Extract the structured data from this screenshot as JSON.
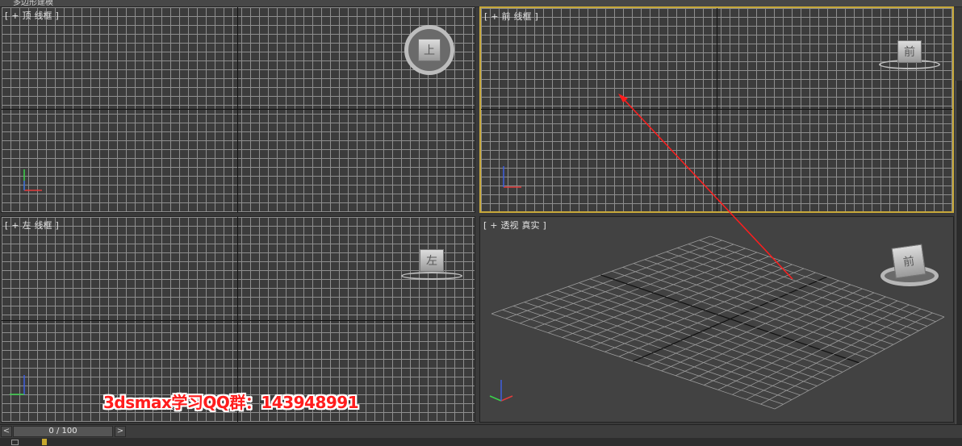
{
  "header": {
    "title": "多边形建模"
  },
  "viewports": {
    "top": {
      "bracket_open": "[",
      "plus": "+",
      "name": "顶",
      "mode": "线框",
      "bracket_close": "]",
      "viewcube_label": "上"
    },
    "front": {
      "bracket_open": "[",
      "plus": "+",
      "name": "前",
      "mode": "线框",
      "bracket_close": "]",
      "viewcube_label": "前"
    },
    "left": {
      "bracket_open": "[",
      "plus": "+",
      "name": "左",
      "mode": "线框",
      "bracket_close": "]",
      "viewcube_label": "左"
    },
    "perspective": {
      "bracket_open": "[",
      "plus": "+",
      "name": "透视",
      "mode": "真实",
      "bracket_close": "]",
      "viewcube_label": "前"
    }
  },
  "timeline": {
    "prev": "<",
    "next": ">",
    "position": "0 / 100"
  },
  "watermark": {
    "text": "3dsmax学习QQ群：143948991"
  },
  "colors": {
    "active_border": "#c7a83a",
    "annotation": "#ff1d1d",
    "axis_x": "#e23b3b",
    "axis_y": "#3bd24b",
    "axis_z": "#3f5fe0"
  },
  "icons": [
    "viewcube-icon",
    "axis-tripod-icon",
    "key-icon"
  ]
}
